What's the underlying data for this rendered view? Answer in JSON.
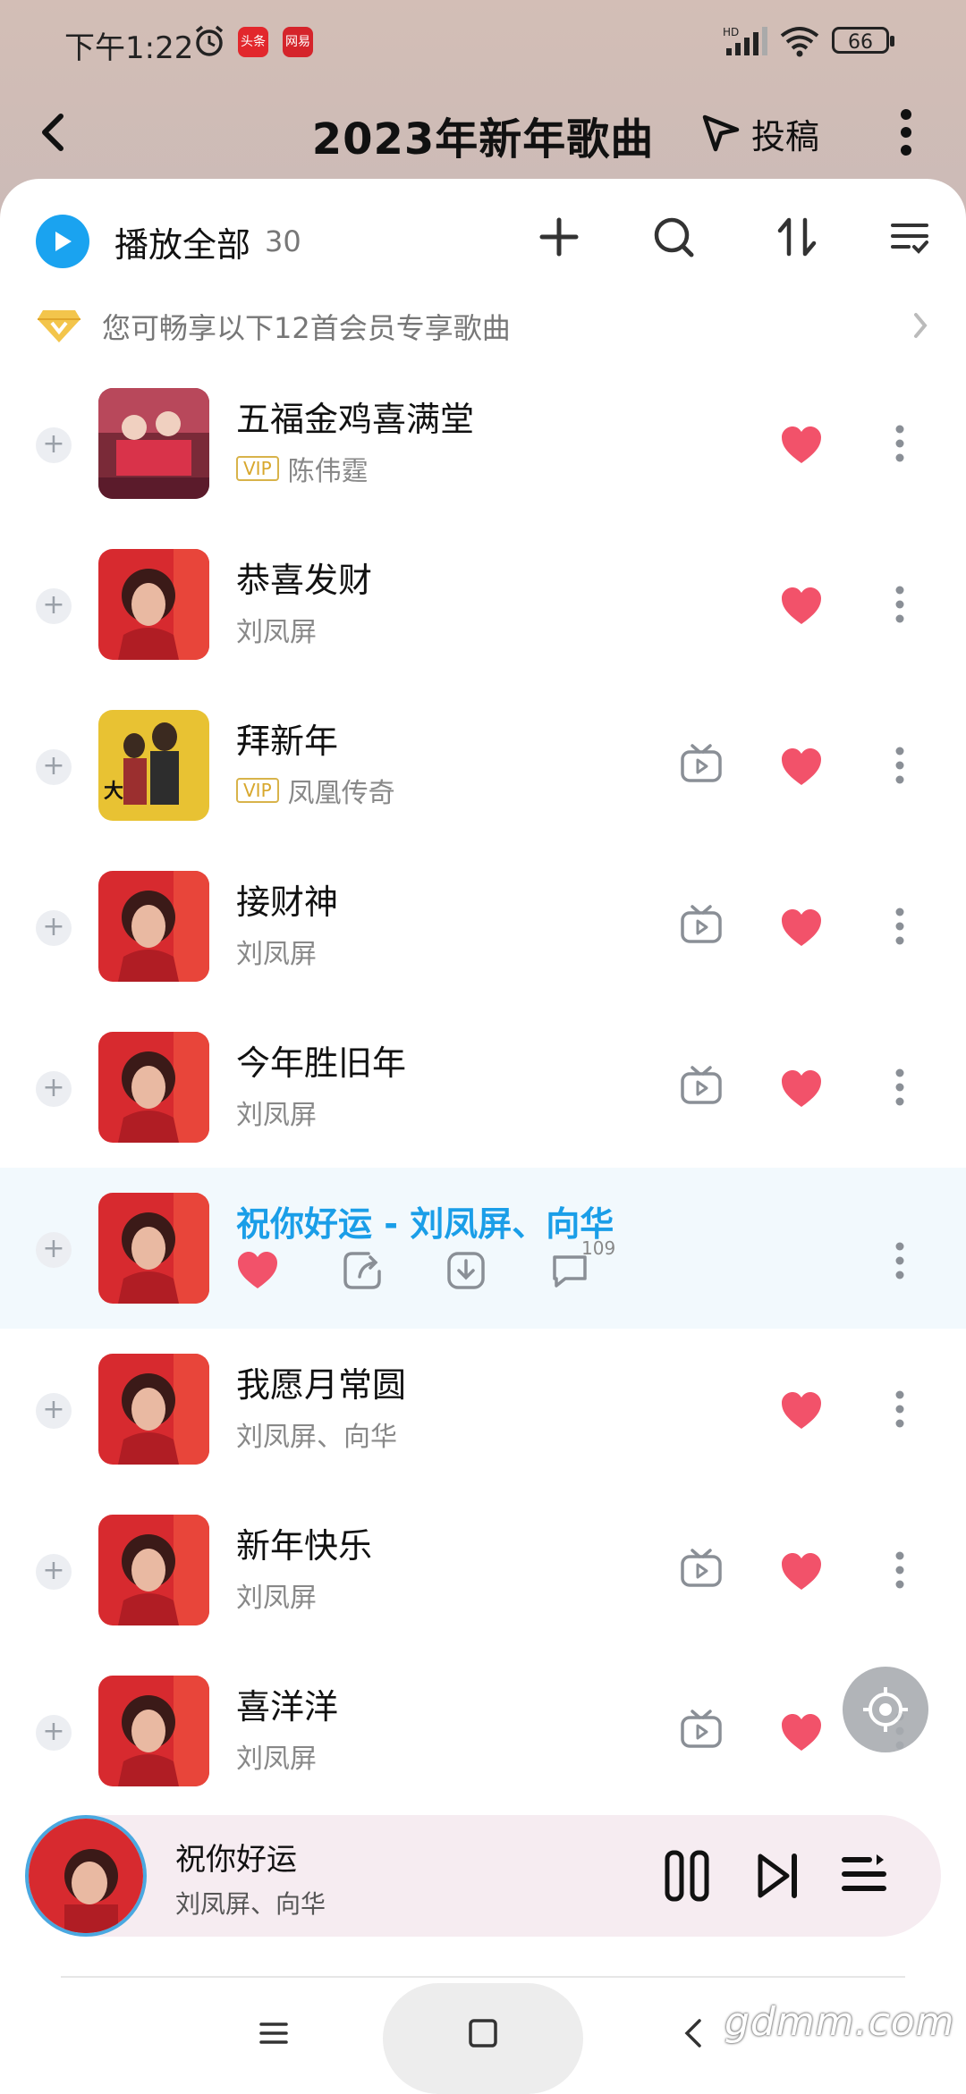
{
  "status_bar": {
    "time": "下午1:22",
    "app_badge_1": "头条",
    "app_badge_2": "网易",
    "battery": "66"
  },
  "header": {
    "title": "2023年新年歌曲",
    "submit_label": "投稿"
  },
  "toolbar": {
    "play_all_label": "播放全部",
    "play_all_count": "30"
  },
  "vip_notice": "您可畅享以下12首会员专享歌曲",
  "songs": [
    {
      "title": "五福金鸡喜满堂",
      "artist": "陈伟霆",
      "vip": "VIP",
      "mv": false
    },
    {
      "title": "恭喜发财",
      "artist": "刘凤屏",
      "vip": "",
      "mv": false
    },
    {
      "title": "拜新年",
      "artist": "凤凰传奇",
      "vip": "VIP",
      "mv": true
    },
    {
      "title": "接财神",
      "artist": "刘凤屏",
      "vip": "",
      "mv": true
    },
    {
      "title": "今年胜旧年",
      "artist": "刘凤屏",
      "vip": "",
      "mv": true
    },
    {
      "title": "祝你好运 - 刘凤屏、向华",
      "artist": "",
      "vip": "",
      "mv": false,
      "comment_count": "109"
    },
    {
      "title": "我愿月常圆",
      "artist": "刘凤屏、向华",
      "vip": "",
      "mv": false
    },
    {
      "title": "新年快乐",
      "artist": "刘凤屏",
      "vip": "",
      "mv": true
    },
    {
      "title": "喜洋洋",
      "artist": "刘凤屏",
      "vip": "",
      "mv": true
    }
  ],
  "mini_player": {
    "title": "祝你好运",
    "artist": "刘凤屏、向华"
  },
  "watermark": "gdmm.com",
  "colors": {
    "accent": "#1aa3f0",
    "heart": "#f2526a",
    "vip": "#d8a72c"
  }
}
